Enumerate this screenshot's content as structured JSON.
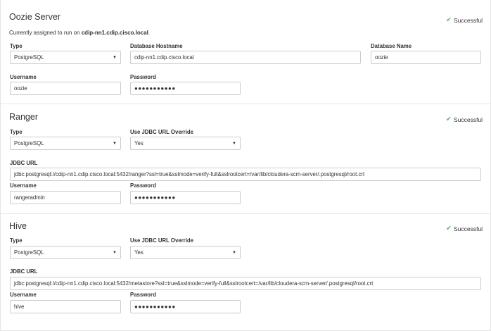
{
  "oozie": {
    "title": "Oozie Server",
    "status": "Successful",
    "assigned_prefix": "Currently assigned to run on ",
    "assigned_host": "cdip-nn1.cdip.cisco.local",
    "assigned_suffix": ".",
    "type_label": "Type",
    "type_value": "PostgreSQL",
    "db_host_label": "Database Hostname",
    "db_host_value": "cdip-nn1.cdip.cisco.local",
    "db_name_label": "Database Name",
    "db_name_value": "oozie",
    "username_label": "Username",
    "username_value": "oozie",
    "password_label": "Password",
    "password_value": "●●●●●●●●●●●"
  },
  "ranger": {
    "title": "Ranger",
    "status": "Successful",
    "type_label": "Type",
    "type_value": "PostgreSQL",
    "override_label": "Use JDBC URL Override",
    "override_value": "Yes",
    "jdbc_label": "JDBC URL",
    "jdbc_value": "jdbc:postgresql://cdip-nn1.cdip.cisco.local:5432/ranger?ssl=true&sslmode=verify-full&sslrootcert=/var/lib/cloudera-scm-server/.postgresql/root.crt",
    "username_label": "Username",
    "username_value": "rangeradmin",
    "password_label": "Password",
    "password_value": "●●●●●●●●●●●"
  },
  "hive": {
    "title": "Hive",
    "status": "Successful",
    "type_label": "Type",
    "type_value": "PostgreSQL",
    "override_label": "Use JDBC URL Override",
    "override_value": "Yes",
    "jdbc_label": "JDBC URL",
    "jdbc_value": "jdbc:postgresql://cdip-nn1.cdip.cisco.local:5432/metastore?ssl=true&sslmode=verify-full&sslrootcert=/var/lib/cloudera-scm-server/.postgresql/root.crt",
    "username_label": "Username",
    "username_value": "hive",
    "password_label": "Password",
    "password_value": "●●●●●●●●●●●"
  },
  "icons": {
    "status": "check-icon",
    "select": "caret-down-icon"
  },
  "colors": {
    "success": "#5cb85c",
    "border": "#cccccc"
  }
}
